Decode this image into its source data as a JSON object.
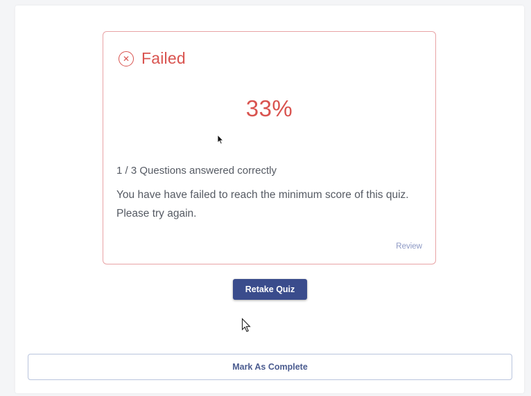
{
  "result": {
    "status": "Failed",
    "status_icon": "close-circle-icon",
    "score": "33%",
    "answered": "1 / 3 Questions answered correctly",
    "message": "You have have failed to reach the minimum score of this quiz. Please try again.",
    "review_label": "Review"
  },
  "actions": {
    "retake_label": "Retake Quiz",
    "complete_label": "Mark As Complete"
  },
  "colors": {
    "fail": "#d9534f",
    "card_border": "#e8a3a5",
    "primary": "#3a4c8c",
    "link": "#8c98c4"
  }
}
